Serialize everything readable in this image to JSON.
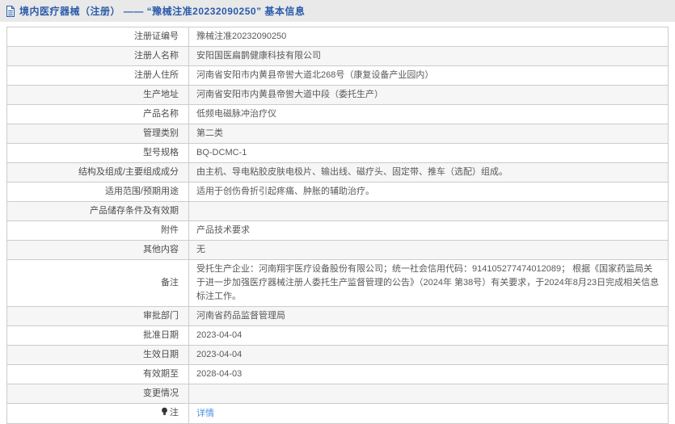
{
  "header": {
    "title": "境内医疗器械（注册） —— “豫械注准20232090250” 基本信息",
    "icon": "document-icon"
  },
  "colors": {
    "title_blue": "#2a5ba9",
    "link_blue": "#4a90e2",
    "stripe_gray": "#f6f6f6",
    "border_gray": "#cccccc",
    "header_bar_gray": "#e9e9e9"
  },
  "table": {
    "rows": [
      {
        "label": "注册证编号",
        "value": "豫械注准20232090250"
      },
      {
        "label": "注册人名称",
        "value": "安阳国医扁鹊健康科技有限公司"
      },
      {
        "label": "注册人住所",
        "value": "河南省安阳市内黄县帝喾大道北268号（康复设备产业园内）"
      },
      {
        "label": "生产地址",
        "value": "河南省安阳市内黄县帝喾大道中段（委托生产）"
      },
      {
        "label": "产品名称",
        "value": "低频电磁脉冲治疗仪"
      },
      {
        "label": "管理类别",
        "value": "第二类"
      },
      {
        "label": "型号规格",
        "value": "BQ-DCMC-1"
      },
      {
        "label": "结构及组成/主要组成成分",
        "value": "由主机、导电粘胶皮肤电极片、输出线、磁疗头、固定带、推车（选配）组成。"
      },
      {
        "label": "适用范围/预期用途",
        "value": "适用于创伤骨折引起疼痛、肿胀的辅助治疗。"
      },
      {
        "label": "产品储存条件及有效期",
        "value": ""
      },
      {
        "label": "附件",
        "value": "产品技术要求"
      },
      {
        "label": "其他内容",
        "value": "无"
      },
      {
        "label": "备注",
        "value": "受托生产企业：河南翔宇医疗设备股份有限公司；统一社会信用代码：914105277474012089； 根据《国家药监局关于进一步加强医疗器械注册人委托生产监督管理的公告》（2024年 第38号）有关要求，于2024年8月23日完成相关信息标注工作。"
      },
      {
        "label": "审批部门",
        "value": "河南省药品监督管理局"
      },
      {
        "label": "批准日期",
        "value": "2023-04-04"
      },
      {
        "label": "生效日期",
        "value": "2023-04-04"
      },
      {
        "label": "有效期至",
        "value": "2028-04-03"
      },
      {
        "label": "变更情况",
        "value": ""
      },
      {
        "label": "注",
        "label_icon": "note-icon",
        "value": "详情",
        "value_type": "link"
      }
    ]
  }
}
